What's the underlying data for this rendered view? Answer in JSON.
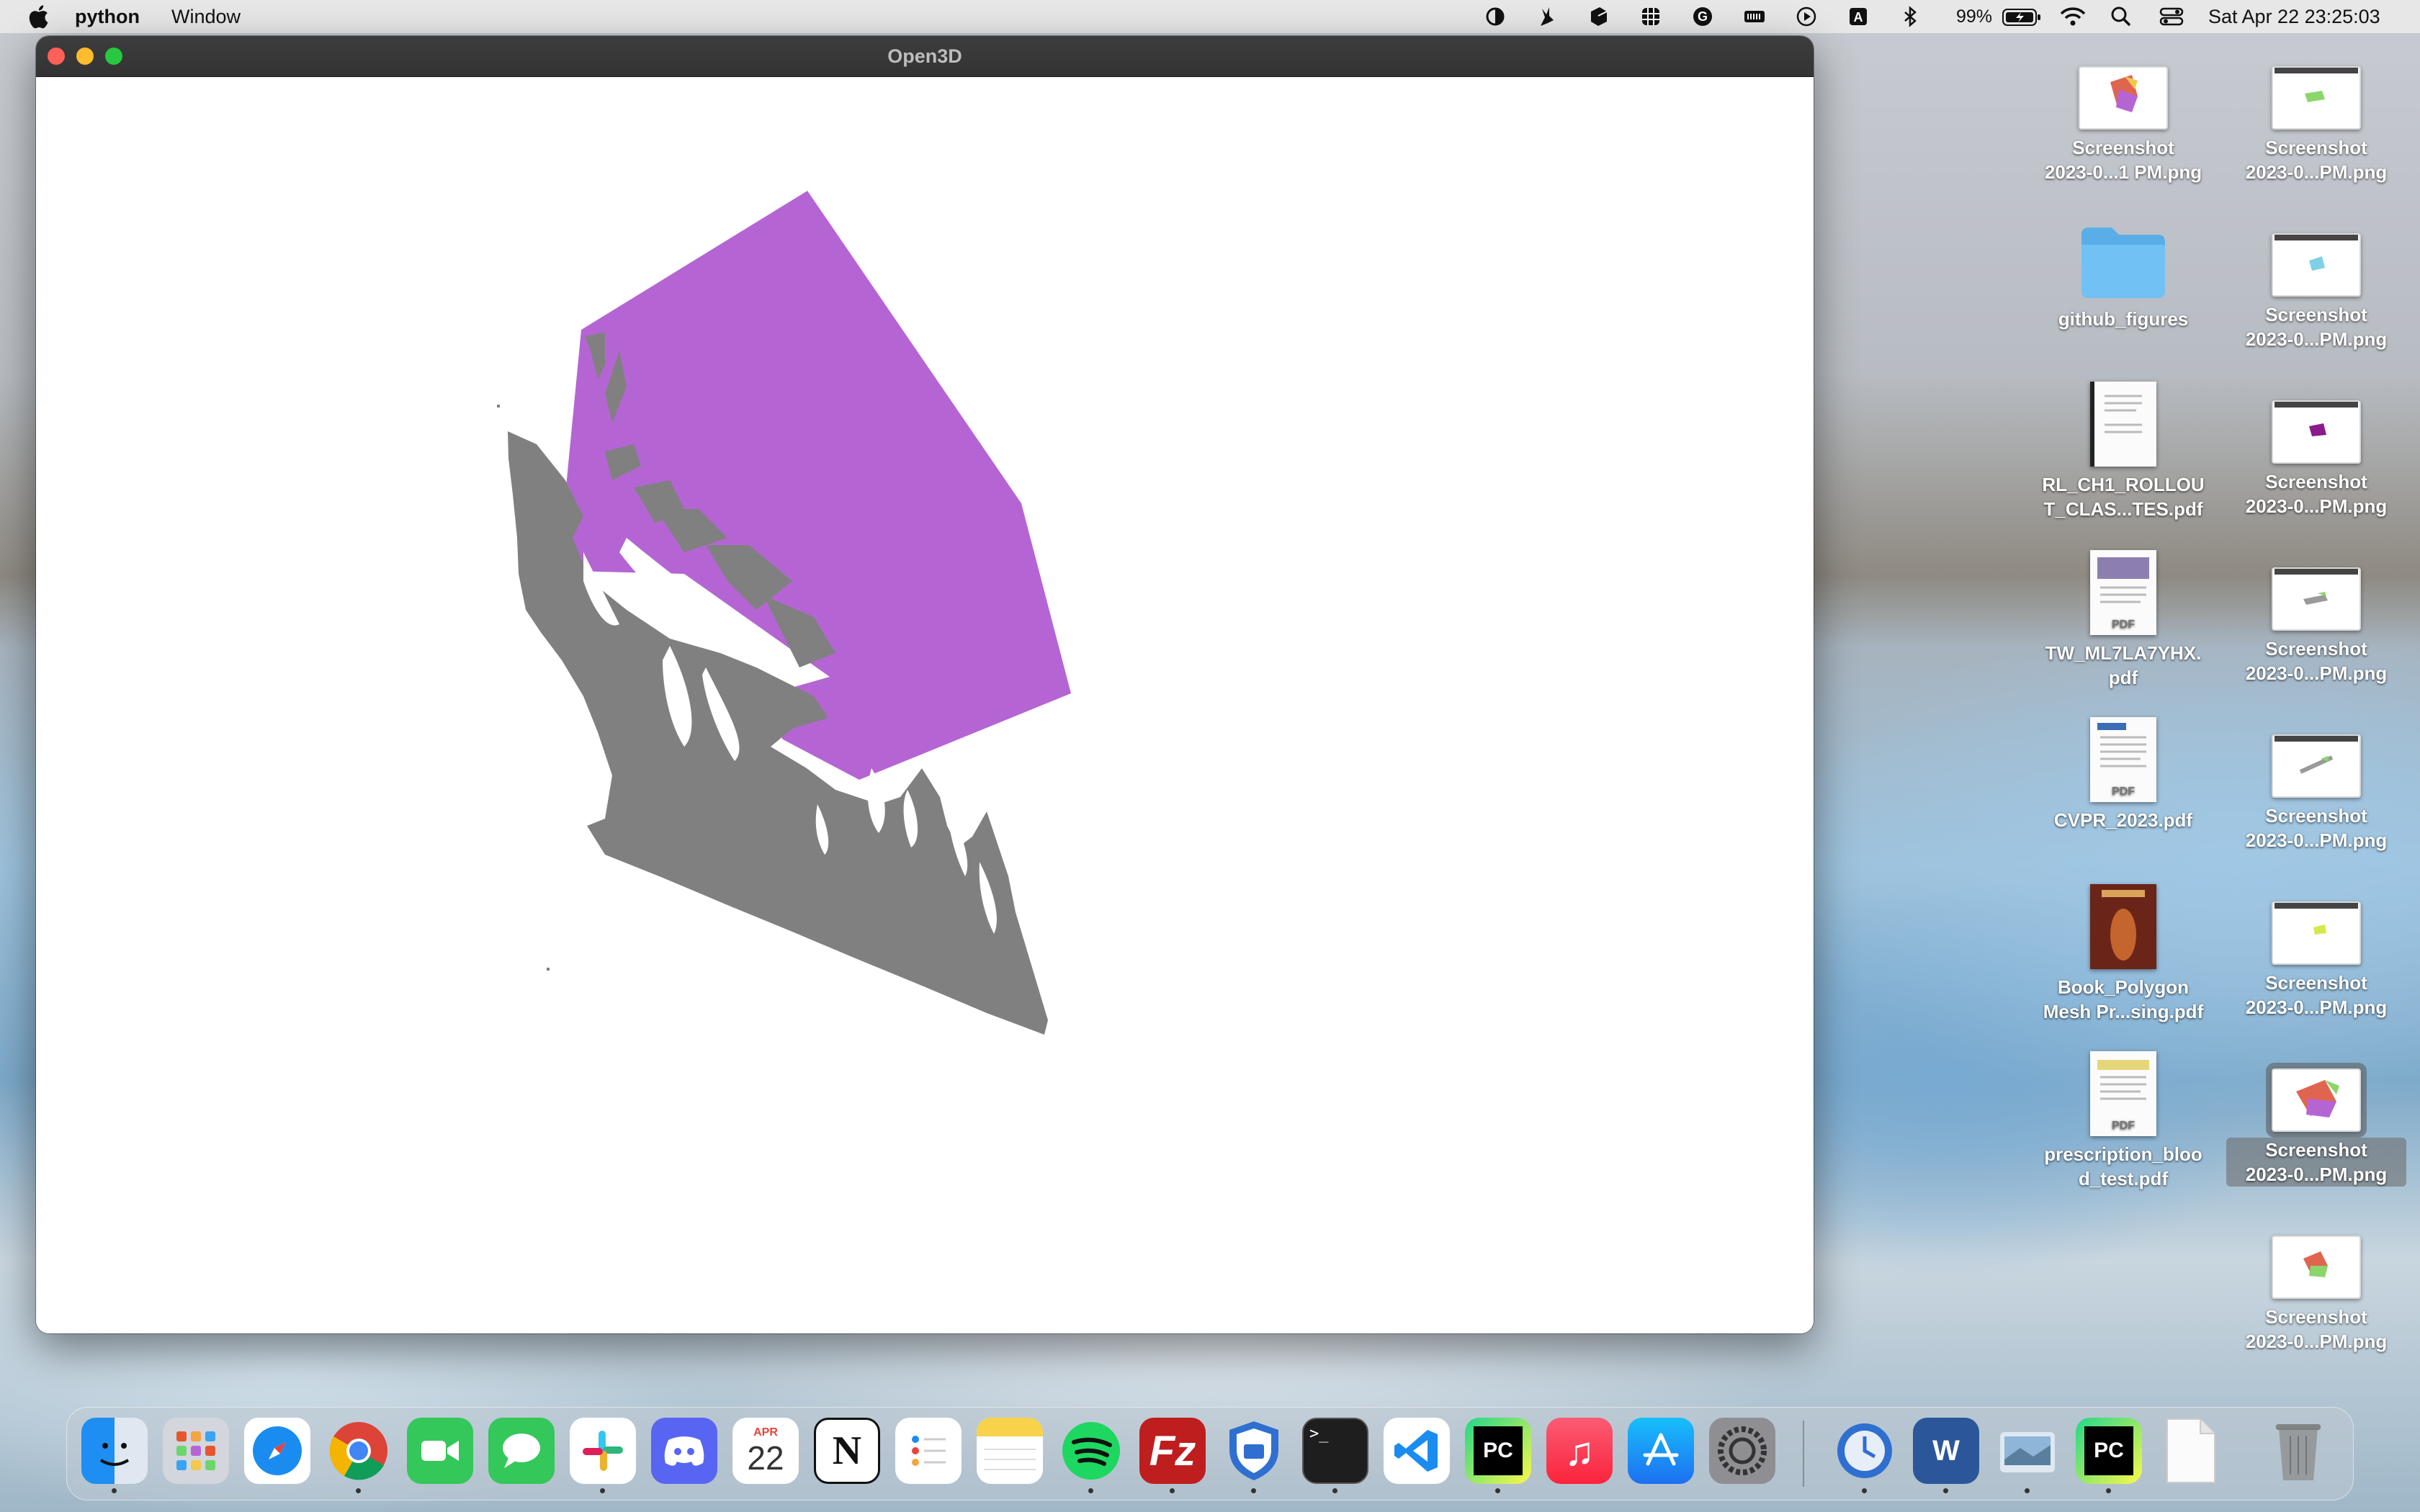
{
  "menubar": {
    "app_name": "python",
    "menu_items": [
      "Window"
    ],
    "battery_percent": "99%",
    "datetime": "Sat Apr 22  23:25:03",
    "status_icons": [
      "focus-moon-icon",
      "rabbit-icon",
      "cube-icon",
      "grid-calendar-icon",
      "grammarly-icon",
      "keyboard-icon",
      "play-icon",
      "input-source-icon",
      "bluetooth-icon"
    ]
  },
  "window": {
    "title": "Open3D"
  },
  "scene": {
    "box_color": "#b565d3",
    "pointcloud_color": "#808080"
  },
  "desktop": {
    "items": [
      {
        "label": "Screenshot 2023-0...1 PM.png",
        "kind": "screenshot"
      },
      {
        "label": "Screenshot 2023-0...PM.png",
        "kind": "screenshot"
      },
      {
        "label": "github_figures",
        "kind": "folder"
      },
      {
        "label": "Screenshot 2023-0...PM.png",
        "kind": "screenshot"
      },
      {
        "label": "RL_CH1_ROLLOUT_CLAS...TES.pdf",
        "kind": "pdf"
      },
      {
        "label": "Screenshot 2023-0...PM.png",
        "kind": "screenshot"
      },
      {
        "label": "TW_ML7LA7YHX.pdf",
        "kind": "pdf"
      },
      {
        "label": "Screenshot 2023-0...PM.png",
        "kind": "screenshot"
      },
      {
        "label": "CVPR_2023.pdf",
        "kind": "pdf"
      },
      {
        "label": "Screenshot 2023-0...PM.png",
        "kind": "screenshot"
      },
      {
        "label": "Book_Polygon Mesh Pr...sing.pdf",
        "kind": "pdf"
      },
      {
        "label": "Screenshot 2023-0...PM.png",
        "kind": "screenshot"
      },
      {
        "label": "prescription_blood_test.pdf",
        "kind": "pdf"
      },
      {
        "label": "Screenshot 2023-0...PM.png",
        "kind": "screenshot"
      },
      {
        "label": "Screenshot 2023-0...PM.png",
        "kind": "screenshot"
      }
    ],
    "label_lines": [
      [
        "Screenshot",
        "2023-0...1 PM.png"
      ],
      [
        "Screenshot",
        "2023-0...PM.png"
      ],
      [
        "github_figures"
      ],
      [
        "Screenshot",
        "2023-0...PM.png"
      ],
      [
        "RL_CH1_ROLLOU",
        "T_CLAS...TES.pdf"
      ],
      [
        "Screenshot",
        "2023-0...PM.png"
      ],
      [
        "TW_ML7LA7YHX.",
        "pdf"
      ],
      [
        "Screenshot",
        "2023-0...PM.png"
      ],
      [
        "CVPR_2023.pdf"
      ],
      [
        "Screenshot",
        "2023-0...PM.png"
      ],
      [
        "Book_Polygon",
        "Mesh Pr...sing.pdf"
      ],
      [
        "Screenshot",
        "2023-0...PM.png"
      ],
      [
        "prescription_bloo",
        "d_test.pdf"
      ],
      [
        "Screenshot",
        "2023-0...PM.png"
      ],
      [
        "Screenshot",
        "2023-0...PM.png"
      ]
    ],
    "pdf_badge": "PDF"
  },
  "dock": {
    "apps": [
      "Finder",
      "Launchpad",
      "Safari",
      "Chrome",
      "FaceTime",
      "Messages",
      "Slack",
      "Discord",
      "Calendar",
      "Notion",
      "Reminders",
      "Notes",
      "Spotify",
      "FileZilla",
      "Security",
      "Terminal",
      "VS Code",
      "PyCharm",
      "Music",
      "App Store",
      "System Settings",
      "Time Machine",
      "Word",
      "Preview",
      "PyCharm",
      "Document",
      "Trash"
    ],
    "calendar_month": "APR",
    "calendar_day": "22",
    "terminal_prompt": ">_"
  }
}
